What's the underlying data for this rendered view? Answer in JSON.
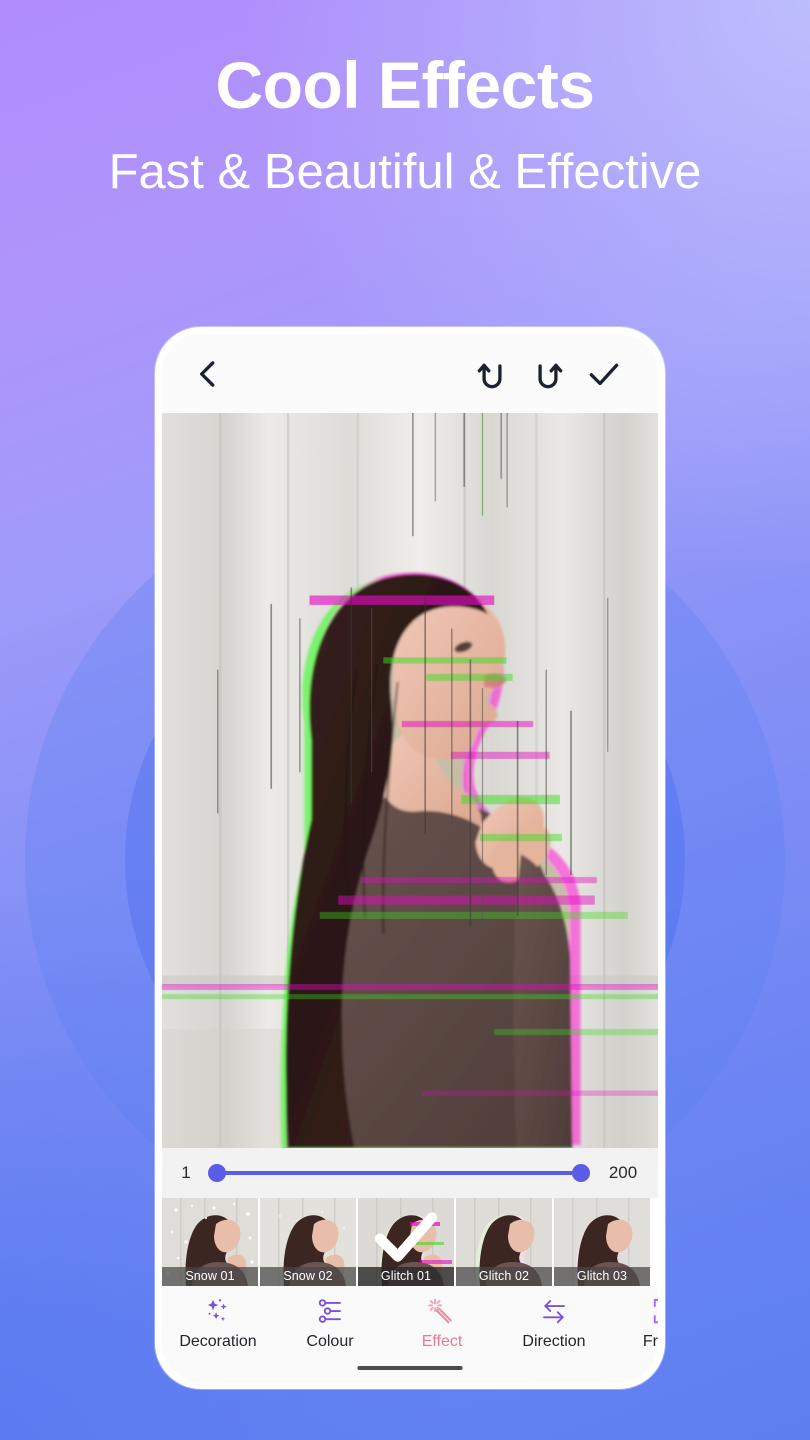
{
  "hero": {
    "title": "Cool Effects",
    "subtitle": "Fast & Beautiful & Effective"
  },
  "colors": {
    "bg_top_left": "#b18cfc",
    "bg_top_right": "#b3b4fb",
    "bg_bottom_left": "#5d7ff0",
    "bg_bottom_right": "#4a6ef0",
    "accent_slider": "#5b5ce8",
    "accent_active_tab": "#e8798f",
    "icon_purple": "#7b4fe0",
    "phone_frame": "#ffffff",
    "glitch_magenta": "#e10cc1",
    "glitch_green": "#3ddb1f"
  },
  "phone": {
    "topbar": {
      "back_label": "Back",
      "undo_label": "Undo",
      "redo_label": "Redo",
      "confirm_label": "Done"
    },
    "slider": {
      "min_value": "1",
      "max_value": "200",
      "low_handle_label": "Start",
      "high_handle_label": "End"
    },
    "effects": [
      {
        "label": "Snow 01",
        "selected": false,
        "kind": "snow"
      },
      {
        "label": "Snow 02",
        "selected": false,
        "kind": "snow2"
      },
      {
        "label": "Glitch 01",
        "selected": true,
        "kind": "glitch1"
      },
      {
        "label": "Glitch 02",
        "selected": false,
        "kind": "glitch2"
      },
      {
        "label": "Glitch 03",
        "selected": false,
        "kind": "glitch3"
      }
    ],
    "bottom_nav": [
      {
        "label": "Decoration",
        "icon": "sparkles-icon",
        "active": false
      },
      {
        "label": "Colour",
        "icon": "sliders-icon",
        "active": false
      },
      {
        "label": "Effect",
        "icon": "magic-wand-icon",
        "active": true
      },
      {
        "label": "Direction",
        "icon": "arrows-icon",
        "active": false
      },
      {
        "label": "Frame",
        "icon": "portrait-frame-icon",
        "active": false
      }
    ]
  }
}
